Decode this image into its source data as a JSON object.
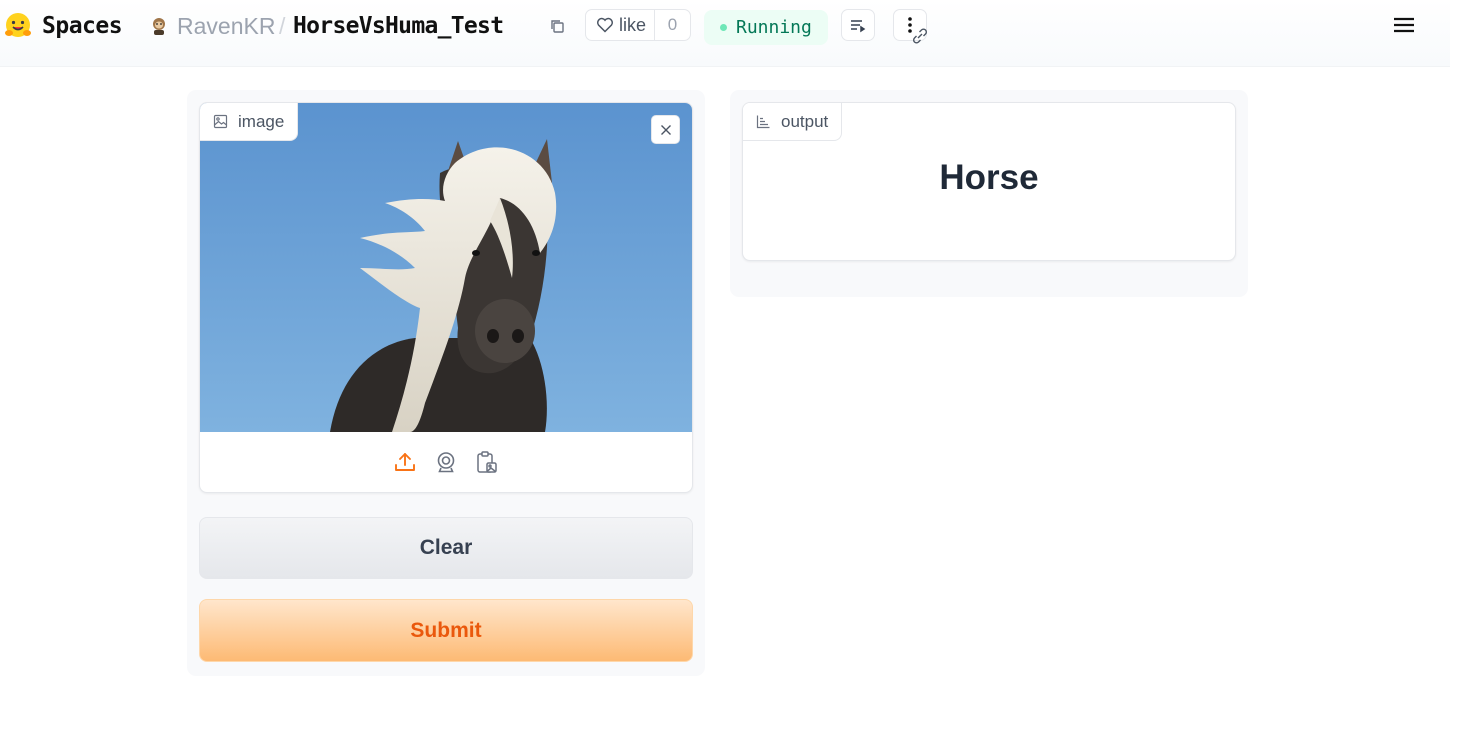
{
  "header": {
    "logo_icon": "hugging-face-emoji-icon",
    "spaces_label": "Spaces",
    "avatar_icon": "user-avatar-icon",
    "owner": "RavenKR",
    "separator": "/",
    "space_name": "HorseVsHuma_Test",
    "copy_icon": "copy-icon",
    "like_label": "like",
    "like_count": "0",
    "status": "Running",
    "colors": {
      "status_bg": "#ecfdf5",
      "status_text": "#047857",
      "status_dot": "#6ee7b7"
    }
  },
  "input": {
    "label": "image",
    "label_icon": "image-icon",
    "close_icon": "close-icon",
    "image_description": "photo of a dark pony with long wind-blown white mane against a blue sky",
    "sources": [
      {
        "name": "upload",
        "icon": "upload-icon"
      },
      {
        "name": "webcam",
        "icon": "webcam-icon"
      },
      {
        "name": "clipboard",
        "icon": "clipboard-icon"
      }
    ]
  },
  "actions": {
    "clear_label": "Clear",
    "submit_label": "Submit",
    "colors": {
      "submit_text": "#ea580c",
      "submit_bg_top": "#ffe6cc",
      "submit_bg_bottom": "#fdba74"
    }
  },
  "output": {
    "label": "output",
    "label_icon": "bar-chart-icon",
    "predicted_label": "Horse"
  }
}
